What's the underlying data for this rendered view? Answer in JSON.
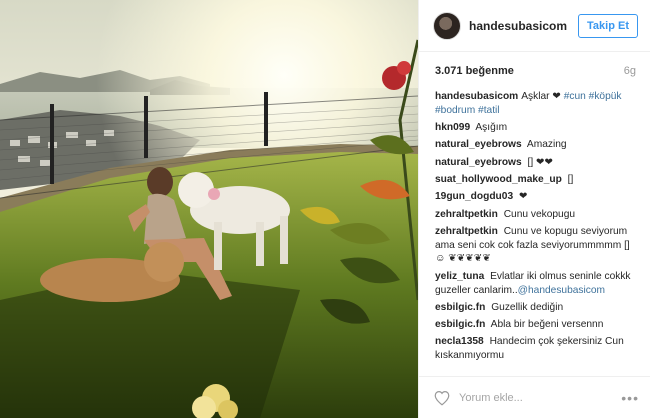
{
  "post": {
    "username": "handesubasicom",
    "follow_label": "Takip Et",
    "likes": "3.071 beğenme",
    "age": "6g"
  },
  "comments": [
    {
      "user": "handesubasicom",
      "text": "Aşklar ❤ ",
      "tags": "#cun #köpük #bodrum #tatil"
    },
    {
      "user": "hkn099",
      "text": "Aşığım"
    },
    {
      "user": "natural_eyebrows",
      "text": "Amazing"
    },
    {
      "user": "natural_eyebrows",
      "text": "[] ❤❤"
    },
    {
      "user": "suat_hollywood_make_up",
      "text": "[]"
    },
    {
      "user": "19gun_dogdu03",
      "text": "❤"
    },
    {
      "user": "zehraltpetkin",
      "text": "Cunu vekopugu"
    },
    {
      "user": "zehraltpetkin",
      "text": "Cunu ve kopugu seviyorum ama seni cok cok fazla seviyorummmmm [] ☺ ❦❦❦❦❦"
    },
    {
      "user": "yeliz_tuna",
      "text": "Evlatlar iki olmus seninle cokkk guzeller canlarim..",
      "mention": "@handesubasicom"
    },
    {
      "user": "esbilgic.fn",
      "text": "Guzellik dediğin"
    },
    {
      "user": "esbilgic.fn",
      "text": "Abla bir beğeni versennn"
    },
    {
      "user": "necla1358",
      "text": "Handecim çok şekersiniz Cun kıskanmıyormu"
    }
  ],
  "footer": {
    "comment_placeholder": "Yorum ekle...",
    "more_label": "•••"
  },
  "icons": {
    "like": "heart-outline-icon",
    "more": "more-options-icon"
  },
  "colors": {
    "accent": "#3897f0",
    "hashtag": "#3f729b"
  }
}
